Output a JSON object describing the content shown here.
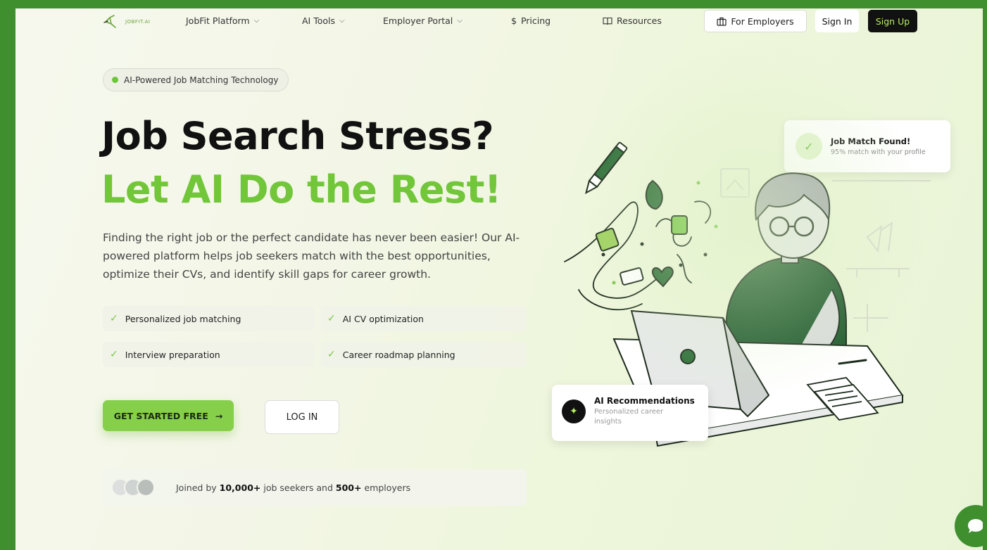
{
  "nav": {
    "logo_text": "JOBFIT.AI",
    "items": [
      {
        "label": "JobFit Platform",
        "has_dropdown": true
      },
      {
        "label": "AI Tools",
        "has_dropdown": true
      },
      {
        "label": "Employer Portal",
        "has_dropdown": true
      },
      {
        "label": "Pricing",
        "icon": "dollar-icon",
        "prefix": "$"
      },
      {
        "label": "Resources",
        "icon": "book-icon"
      }
    ],
    "for_employers": "For Employers",
    "sign_in": "Sign In",
    "sign_up": "Sign Up"
  },
  "hero": {
    "badge": "AI-Powered Job Matching Technology",
    "headline_line1": "Job Search Stress?",
    "headline_line2": "Let AI Do the Rest!",
    "lede": "Finding the right job or the perfect candidate has never been easier! Our AI-powered platform helps job seekers match with the best opportunities, optimize their CVs, and identify skill gaps for career growth.",
    "features": [
      "Personalized job matching",
      "AI CV optimization",
      "Interview preparation",
      "Career roadmap planning"
    ],
    "cta_primary": "GET STARTED FREE",
    "cta_primary_arrow": "→",
    "cta_secondary": "LOG IN",
    "joined_prefix": "Joined by",
    "joined_seekers": "10,000+",
    "joined_middle": "job seekers and",
    "joined_employers": "500+",
    "joined_suffix": "employers"
  },
  "cards": {
    "match_title": "Job Match Found!",
    "match_sub": "95% match with your profile",
    "reco_title": "AI Recommendations",
    "reco_sub": "Personalized career insights"
  },
  "colors": {
    "accent": "#72c63a",
    "frame": "#3f8f2f",
    "dark": "#111111",
    "signup_text": "#b9ef5d"
  }
}
